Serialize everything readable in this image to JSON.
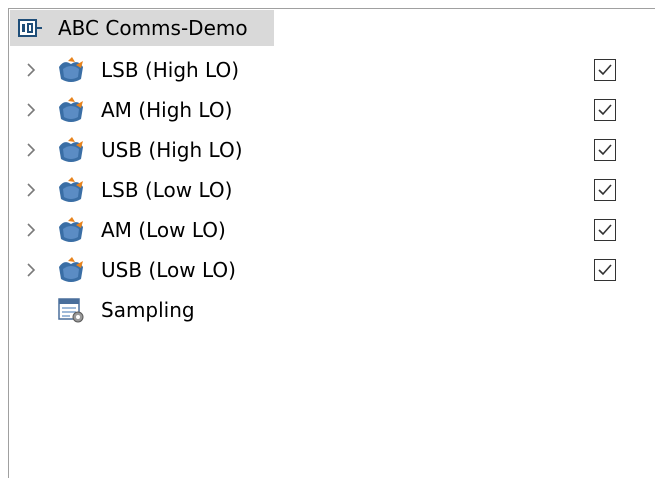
{
  "tree": {
    "root": {
      "label": "ABC Comms-Demo",
      "icon": "project-icon",
      "selected": true
    },
    "items": [
      {
        "label": "LSB (High LO)",
        "icon": "waveform-block-icon",
        "expandable": true,
        "checked": true
      },
      {
        "label": "AM (High LO)",
        "icon": "waveform-block-icon",
        "expandable": true,
        "checked": true
      },
      {
        "label": "USB (High LO)",
        "icon": "waveform-block-icon",
        "expandable": true,
        "checked": true
      },
      {
        "label": "LSB (Low LO)",
        "icon": "waveform-block-icon",
        "expandable": true,
        "checked": true
      },
      {
        "label": "AM (Low LO)",
        "icon": "waveform-block-icon",
        "expandable": true,
        "checked": true
      },
      {
        "label": "USB (Low LO)",
        "icon": "waveform-block-icon",
        "expandable": true,
        "checked": true
      },
      {
        "label": "Sampling",
        "icon": "sampling-settings-icon",
        "expandable": false,
        "checked": null
      }
    ]
  },
  "colors": {
    "selection_bg": "#d9d9d9",
    "icon_blue": "#2e5c8a",
    "icon_orange": "#e8831c",
    "chevron": "#7a7a7a",
    "checkbox_border": "#333333"
  }
}
